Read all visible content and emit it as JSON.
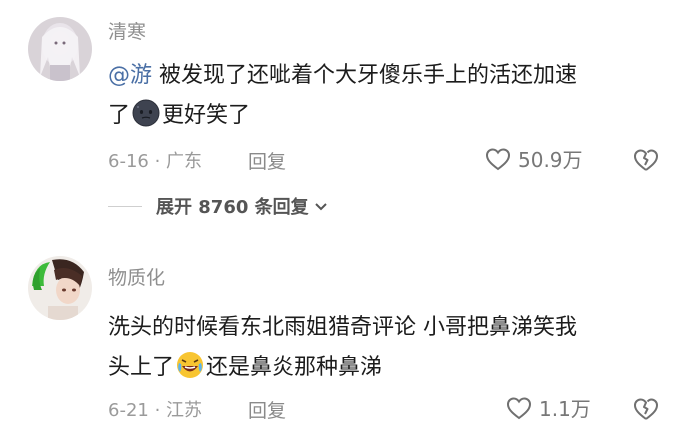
{
  "comments": [
    {
      "username": "清寒",
      "mention": "@游",
      "text_line1": " 被发现了还呲着个大牙傻乐手上的活还加速",
      "text_line2_pre": "了",
      "text_line2_post": "更好笑了",
      "emoji": "dark-face-emoji",
      "date_location": "6-16 · 广东",
      "reply_label": "回复",
      "likes": "50.9万",
      "expand_label": "展开 8760 条回复"
    },
    {
      "username": "物质化",
      "text_line1": "洗头的时候看东北雨姐猎奇评论 小哥把鼻涕笑我",
      "text_line2_pre": "头上了",
      "text_line2_post": "还是鼻炎那种鼻涕",
      "emoji": "rolling-laughing-emoji",
      "date_location": "6-21 · 江苏",
      "reply_label": "回复",
      "likes": "1.1万"
    }
  ],
  "colors": {
    "mention": "#4a6fa5",
    "meta": "#9a9a9a"
  }
}
